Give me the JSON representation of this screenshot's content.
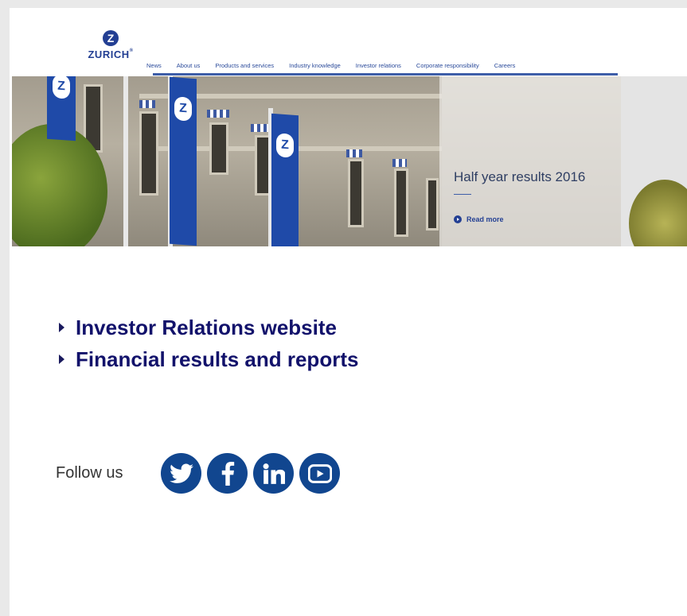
{
  "brand": {
    "logo_letter": "Z",
    "logo_text": "ZURICH"
  },
  "nav": {
    "items": [
      "News",
      "About us",
      "Products and services",
      "Industry knowledge",
      "Investor relations",
      "Corporate responsibility",
      "Careers"
    ]
  },
  "hero": {
    "title": "Half year results 2016",
    "read_more": "Read more"
  },
  "links": {
    "items": [
      "Investor Relations website",
      "Financial results and reports"
    ]
  },
  "follow": {
    "label": "Follow us",
    "icons": [
      "twitter-icon",
      "facebook-icon",
      "linkedin-icon",
      "youtube-icon"
    ]
  },
  "colors": {
    "brand_blue": "#233f93",
    "link_navy": "#12126b",
    "social_blue": "#11468f"
  }
}
